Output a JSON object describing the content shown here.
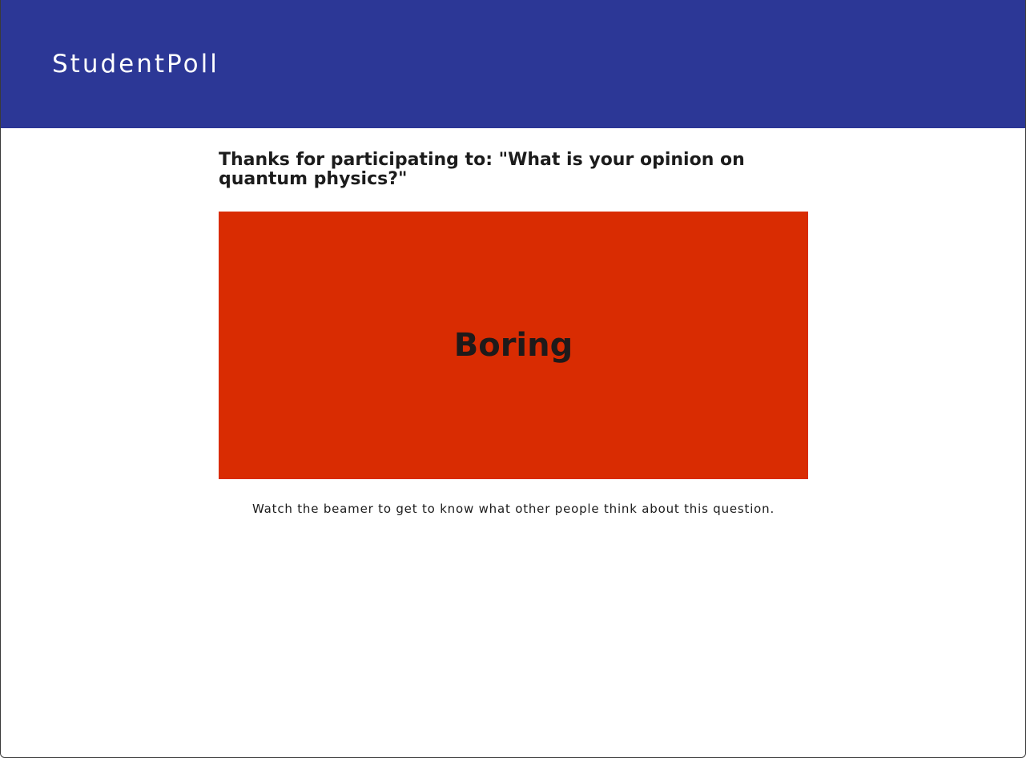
{
  "header": {
    "brand": "StudentPoll",
    "background_color": "#2c3796"
  },
  "main": {
    "thanks_text": "Thanks for participating to: \"What is your opinion on quantum physics?\"",
    "answer": {
      "label": "Boring",
      "color": "#d92c02"
    },
    "note": "Watch the beamer to get to know what other people think about this question."
  }
}
